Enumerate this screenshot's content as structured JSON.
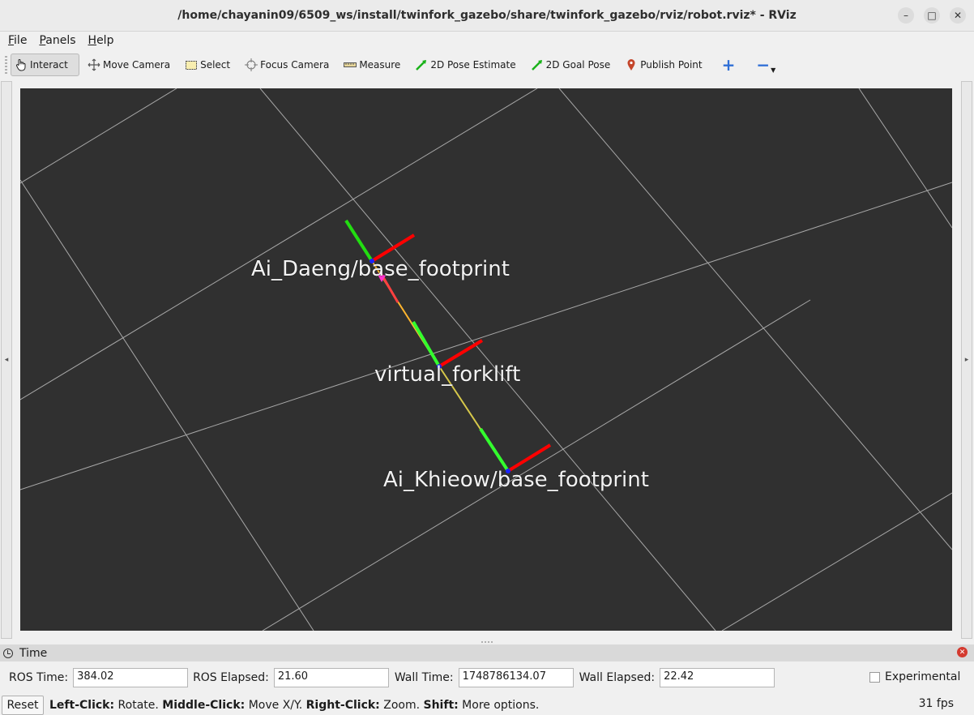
{
  "window": {
    "title": "/home/chayanin09/6509_ws/install/twinfork_gazebo/share/twinfork_gazebo/rviz/robot.rviz* - RViz",
    "minimize_glyph": "–",
    "maximize_glyph": "□",
    "close_glyph": "✕"
  },
  "menubar": {
    "items": [
      {
        "first": "F",
        "rest": "ile"
      },
      {
        "first": "P",
        "rest": "anels"
      },
      {
        "first": "H",
        "rest": "elp"
      }
    ]
  },
  "toolbar": {
    "interact": "Interact",
    "move_camera": "Move Camera",
    "select": "Select",
    "focus_camera": "Focus Camera",
    "measure": "Measure",
    "pose_estimate": "2D Pose Estimate",
    "goal_pose": "2D Goal Pose",
    "publish_point": "Publish Point",
    "add_glyph": "+",
    "remove_glyph": "−"
  },
  "viewport": {
    "background": "#303030",
    "frames": [
      {
        "name": "Ai_Daeng/base_footprint",
        "overlay": "Ai_Daeng/bas"
      },
      {
        "name": "virtual_forklift"
      },
      {
        "name": "Ai_Khieow/base_footprint"
      }
    ],
    "axis_colors": {
      "x": "#ff0000",
      "y": "#00ff00",
      "z": "#0000ff"
    }
  },
  "time_panel": {
    "title": "Time",
    "ros_time_label": "ROS Time:",
    "ros_time": "384.02",
    "ros_elapsed_label": "ROS Elapsed:",
    "ros_elapsed": "21.60",
    "wall_time_label": "Wall Time:",
    "wall_time": "1748786134.07",
    "wall_elapsed_label": "Wall Elapsed:",
    "wall_elapsed": "22.42",
    "experimental_label": "Experimental",
    "experimental_checked": false
  },
  "status": {
    "reset": "Reset",
    "hint_parts": [
      {
        "k": "Left-Click:",
        "v": " Rotate. "
      },
      {
        "k": "Middle-Click:",
        "v": " Move X/Y. "
      },
      {
        "k": "Right-Click:",
        "v": " Zoom. "
      },
      {
        "k": "Shift:",
        "v": " More options."
      }
    ],
    "fps": "31 fps"
  }
}
